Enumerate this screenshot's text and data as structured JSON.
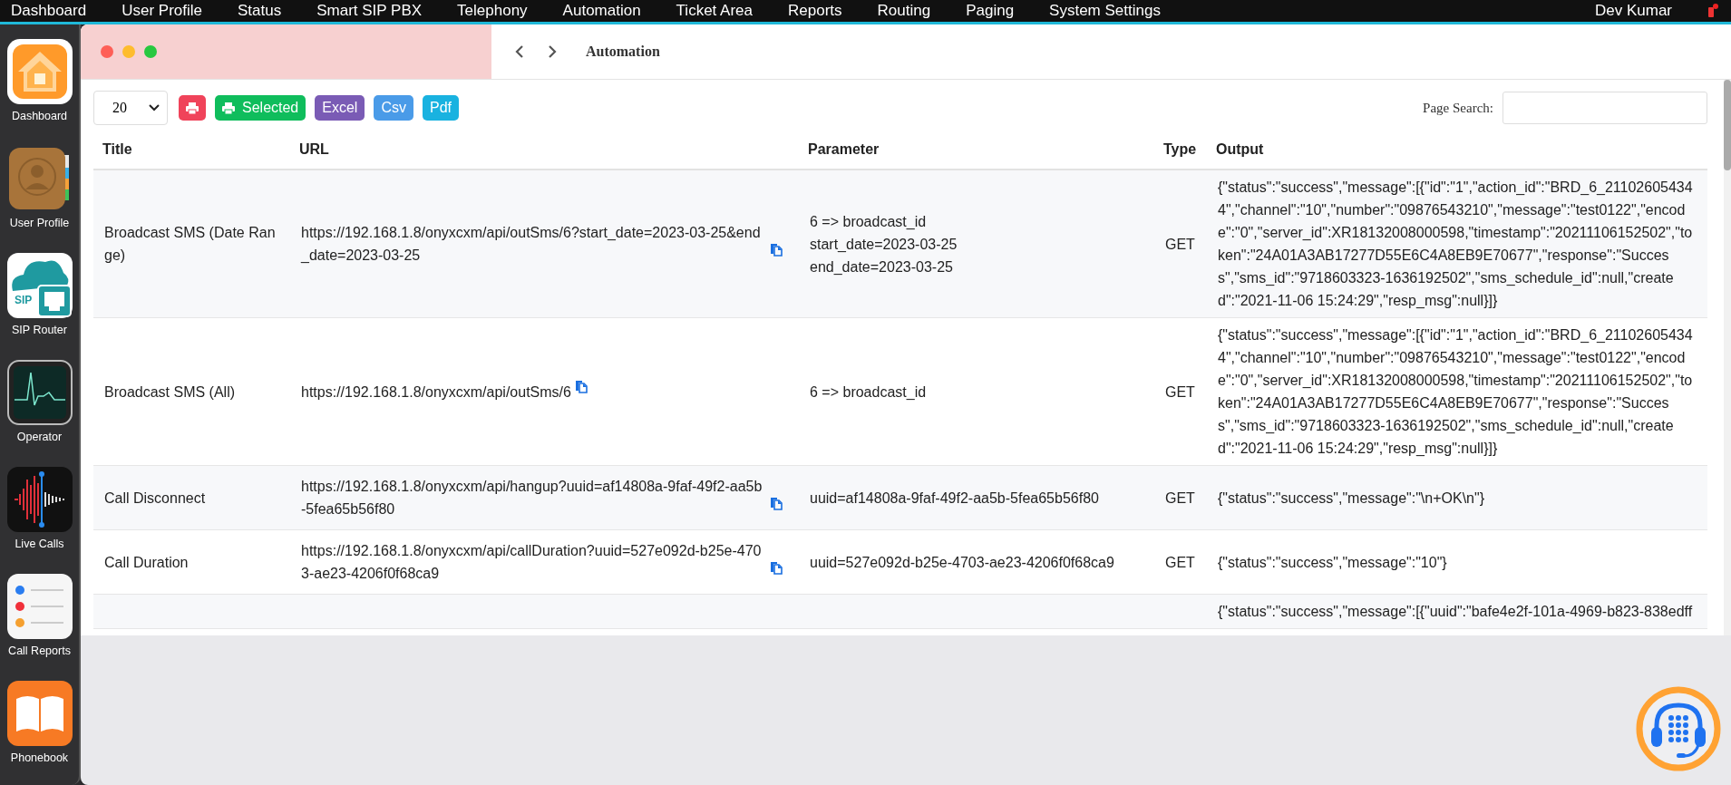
{
  "menu_bar": {
    "items": [
      "Dashboard",
      "User Profile",
      "Status",
      "Smart SIP PBX",
      "Telephony",
      "Automation",
      "Ticket Area",
      "Reports",
      "Routing",
      "Paging",
      "System Settings"
    ],
    "user": "Dev Kumar"
  },
  "dock": {
    "apps": [
      {
        "label": "Dashboard",
        "kind": "home"
      },
      {
        "label": "User Profile",
        "kind": "contacts"
      },
      {
        "label": "SIP Router",
        "kind": "sip",
        "icon_text": "SIP"
      },
      {
        "label": "Operator",
        "kind": "monitor"
      },
      {
        "label": "Live Calls",
        "kind": "wave"
      },
      {
        "label": "Call Reports",
        "kind": "list"
      },
      {
        "label": "Phonebook",
        "kind": "book"
      }
    ]
  },
  "window": {
    "title": "Automation"
  },
  "toolbar": {
    "page_size": "20",
    "buttons": [
      {
        "kind": "print",
        "color": "#f0435a"
      },
      {
        "kind": "print",
        "label": "Selected",
        "color": "#0fbd5c"
      },
      {
        "kind": "text",
        "label": "Excel",
        "color": "#7a5bb5"
      },
      {
        "kind": "text",
        "label": "Csv",
        "color": "#4a9be8"
      },
      {
        "kind": "text",
        "label": "Pdf",
        "color": "#19b2e0"
      }
    ],
    "search_label": "Page Search:"
  },
  "table": {
    "columns": [
      "Title",
      "URL",
      "Parameter",
      "Type",
      "Output"
    ],
    "rows": [
      {
        "title": "Broadcast SMS (Date Range)",
        "url": "https://192.168.1.8/onyxcxm/api/outSms/6?start_date=2023-03-25&end_date=2023-03-25",
        "parameter": [
          "6 => broadcast_id",
          "start_date=2023-03-25",
          "end_date=2023-03-25"
        ],
        "type": "GET",
        "output": "{\"status\":\"success\",\"message\":[{\"id\":\"1\",\"action_id\":\"BRD_6_211026054344\",\"channel\":\"10\",\"number\":\"09876543210\",\"message\":\"test0122\",\"encode\":\"0\",\"server_id\":XR18132008000598,\"timestamp\":\"20211106152502\",\"token\":\"24A01A3AB17277D55E6C4A8EB9E70677\",\"response\":\"Success\",\"sms_id\":\"9718603323-1636192502\",\"sms_schedule_id\":null,\"created\":\"2021-11-06 15:24:29\",\"resp_msg\":null}]}"
      },
      {
        "title": "Broadcast SMS (All)",
        "url": "https://192.168.1.8/onyxcxm/api/outSms/6",
        "parameter": [
          "6 => broadcast_id"
        ],
        "type": "GET",
        "output": "{\"status\":\"success\",\"message\":[{\"id\":\"1\",\"action_id\":\"BRD_6_211026054344\",\"channel\":\"10\",\"number\":\"09876543210\",\"message\":\"test0122\",\"encode\":\"0\",\"server_id\":XR18132008000598,\"timestamp\":\"20211106152502\",\"token\":\"24A01A3AB17277D55E6C4A8EB9E70677\",\"response\":\"Success\",\"sms_id\":\"9718603323-1636192502\",\"sms_schedule_id\":null,\"created\":\"2021-11-06 15:24:29\",\"resp_msg\":null}]}"
      },
      {
        "title": "Call Disconnect",
        "url": "https://192.168.1.8/onyxcxm/api/hangup?uuid=af14808a-9faf-49f2-aa5b-5fea65b56f80",
        "parameter": [
          "uuid=af14808a-9faf-49f2-aa5b-5fea65b56f80"
        ],
        "type": "GET",
        "output": "{\"status\":\"success\",\"message\":\"\\n+OK\\n\"}"
      },
      {
        "title": "Call Duration",
        "url": "https://192.168.1.8/onyxcxm/api/callDuration?uuid=527e092d-b25e-4703-ae23-4206f0f68ca9",
        "parameter": [
          "uuid=527e092d-b25e-4703-ae23-4206f0f68ca9"
        ],
        "type": "GET",
        "output": "{\"status\":\"success\",\"message\":\"10\"}"
      },
      {
        "output": "{\"status\":\"success\",\"message\":[{\"uuid\":\"bafe4e2f-101a-4969-b823-838edff"
      }
    ]
  }
}
